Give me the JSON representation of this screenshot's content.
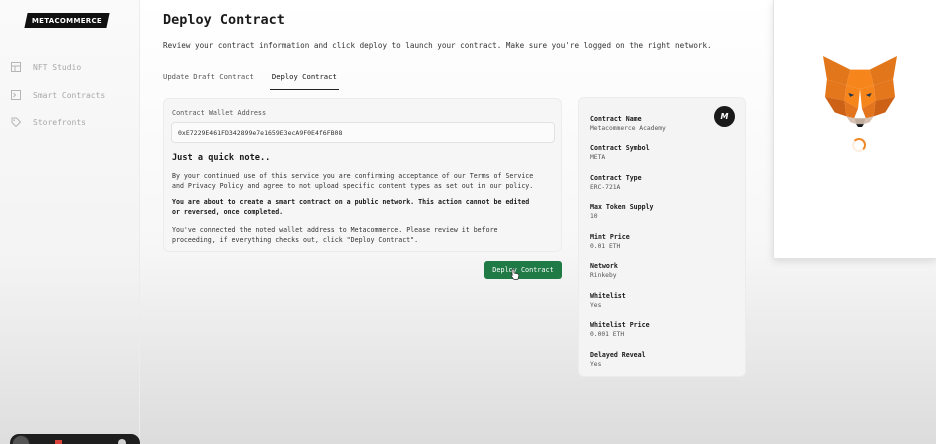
{
  "brand": {
    "logo_text": "METACOMMERCE"
  },
  "sidebar": {
    "items": [
      {
        "label": "NFT Studio",
        "icon": "grid-icon"
      },
      {
        "label": "Smart Contracts",
        "icon": "terminal-icon"
      },
      {
        "label": "Storefronts",
        "icon": "tag-icon"
      }
    ]
  },
  "header": {
    "title": "Deploy Contract",
    "subtitle": "Review your contract information and click deploy to launch your contract. Make sure you're logged on the right network."
  },
  "tabs": [
    {
      "label": "Update Draft Contract",
      "active": false
    },
    {
      "label": "Deploy Contract",
      "active": true
    }
  ],
  "wallet": {
    "label": "Contract Wallet Address",
    "value": "0xE7229E461FD342899e7e1659E3ecA9F0E4f6FB08"
  },
  "note": {
    "heading": "Just a quick note..",
    "paragraph1_line1": "By your continued use of this service you are confirming acceptance of our Terms of Service",
    "paragraph1_line2": "and Privacy Policy and agree to not upload specific content types as set out in our policy.",
    "paragraph2_line1": "You are about to create a smart contract on a public network. This action cannot be edited",
    "paragraph2_line2": "or reversed, once completed.",
    "paragraph3_line1": "You've connected the noted wallet address to Metacommerce. Please review it before",
    "paragraph3_line2": "proceeding, if everything checks out, click \"Deploy Contract\"."
  },
  "actions": {
    "deploy_label": "Deploy Contract"
  },
  "summary": {
    "avatar_letter": "M",
    "fields": [
      {
        "key": "Contract Name",
        "value": "Metacommerce Academy"
      },
      {
        "key": "Contract Symbol",
        "value": "META"
      },
      {
        "key": "Contract Type",
        "value": "ERC-721A"
      },
      {
        "key": "Max Token Supply",
        "value": "10"
      },
      {
        "key": "Mint Price",
        "value": "0.01 ETH"
      },
      {
        "key": "Network",
        "value": "Rinkeby"
      },
      {
        "key": "Whitelist",
        "value": "Yes"
      },
      {
        "key": "Whitelist Price",
        "value": "0.001 ETH"
      },
      {
        "key": "Delayed Reveal",
        "value": "Yes"
      }
    ]
  },
  "colors": {
    "accent_green": "#1f7a45",
    "metamask_orange": "#f08a28"
  }
}
